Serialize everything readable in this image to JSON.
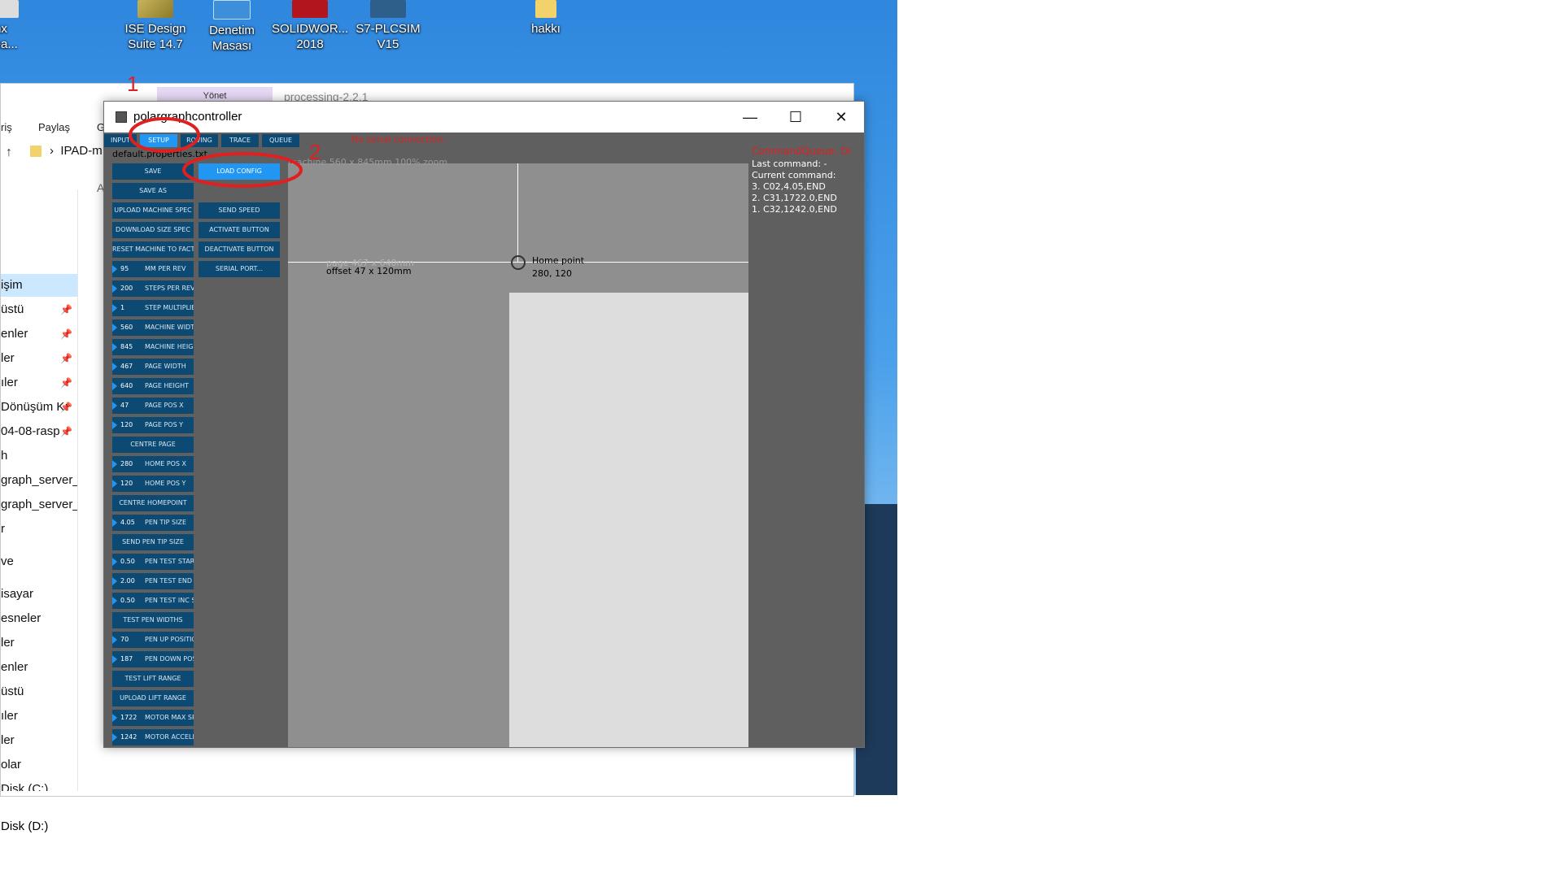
{
  "desktop": {
    "icons": [
      {
        "label1": "nx",
        "label2": "thea..."
      },
      {
        "label1": "ISE Design",
        "label2": "Suite 14.7"
      },
      {
        "label1": "Denetim",
        "label2": "Masası"
      },
      {
        "label1": "SOLIDWOR...",
        "label2": "2018"
      },
      {
        "label1": "S7-PLCSIM",
        "label2": "V15"
      },
      {
        "label1": "hakkı",
        "label2": ""
      }
    ]
  },
  "explorer": {
    "ribbon_tab_1": "Yönet",
    "title": "processing-2.2.1",
    "ribbon_items": [
      "riş",
      "Paylaş",
      "Gö"
    ],
    "address": "IPAD-m",
    "nav_items": [
      "işim",
      "üstü",
      "enler",
      "ler",
      "ıler",
      "Dönüşüm Kı",
      "04-08-rasp",
      "h",
      "graph_server_a",
      "graph_server_a",
      "r",
      "ve",
      "isayar",
      "esneler",
      "ler",
      "enler",
      "üstü",
      "ıler",
      "ler",
      "olar",
      "Disk (C:)",
      "Disk (D:)"
    ],
    "side_letters": [
      "A"
    ]
  },
  "app": {
    "title": "polargraphcontroller",
    "controls": {
      "minimize": "—",
      "maximize": "☐",
      "close": "✕"
    },
    "tabs": [
      "INPUT",
      "SETUP",
      "ROVING",
      "TRACE",
      "QUEUE"
    ],
    "active_tab": "SETUP",
    "status": "No serial connection.",
    "properties_file": "default.properties.txt",
    "buttons": {
      "save": "SAVE",
      "load_config": "LOAD CONFIG",
      "save_as": "SAVE AS",
      "upload_machine_spec": "UPLOAD MACHINE SPEC",
      "send_speed": "SEND SPEED",
      "download_size_spec": "DOWNLOAD SIZE SPEC",
      "activate_button": "ACTIVATE BUTTON",
      "reset_machine": "RESET MACHINE TO FACTORY",
      "deactivate_button": "DEACTIVATE BUTTON",
      "serial_port": "SERIAL PORT...",
      "centre_page": "CENTRE PAGE",
      "centre_homepoint": "CENTRE HOMEPOINT",
      "send_pen_tip_size": "SEND PEN TIP SIZE",
      "test_pen_widths": "TEST PEN WIDTHS",
      "test_lift_range": "TEST LIFT RANGE",
      "upload_lift_range": "UPLOAD LIFT RANGE"
    },
    "params": [
      {
        "value": "95",
        "label": "MM PER REV"
      },
      {
        "value": "200",
        "label": "STEPS PER REV"
      },
      {
        "value": "1",
        "label": "STEP MULTIPLIER"
      },
      {
        "value": "560",
        "label": "MACHINE WIDTH"
      },
      {
        "value": "845",
        "label": "MACHINE HEIGHT"
      },
      {
        "value": "467",
        "label": "PAGE WIDTH"
      },
      {
        "value": "640",
        "label": "PAGE HEIGHT"
      },
      {
        "value": "47",
        "label": "PAGE POS X"
      },
      {
        "value": "120",
        "label": "PAGE POS Y"
      },
      {
        "value": "280",
        "label": "HOME POS X"
      },
      {
        "value": "120",
        "label": "HOME POS Y"
      },
      {
        "value": "4.05",
        "label": "PEN TIP SIZE"
      },
      {
        "value": "0.50",
        "label": "PEN TEST START TIP"
      },
      {
        "value": "2.00",
        "label": "PEN TEST END TIP"
      },
      {
        "value": "0.50",
        "label": "PEN TEST INC SIZE"
      },
      {
        "value": "70",
        "label": "PEN UP POSITION"
      },
      {
        "value": "187",
        "label": "PEN DOWN POSITION"
      },
      {
        "value": "1722",
        "label": "MOTOR MAX SPEED"
      },
      {
        "value": "1242",
        "label": "MOTOR ACCELERATION"
      }
    ],
    "machine_info": "machine 560 x 845mm 100% zoom",
    "page_info": "page 467 x 640mm",
    "offset_info": "offset 47 x 120mm",
    "home_label": "Home point",
    "home_coords": "280, 120",
    "queue": {
      "title": "CommandQueue: Ol",
      "last_command": "Last command: -",
      "current_command": "Current command:",
      "items": [
        "3. C02,4.05,END",
        "2. C31,1722.0,END",
        "1. C32,1242.0,END"
      ]
    }
  },
  "annotations": [
    "1",
    "2"
  ],
  "colors": {
    "button": "#0c4a74",
    "active": "#2196f3",
    "annotation": "#e02020",
    "status": "#e02020"
  }
}
